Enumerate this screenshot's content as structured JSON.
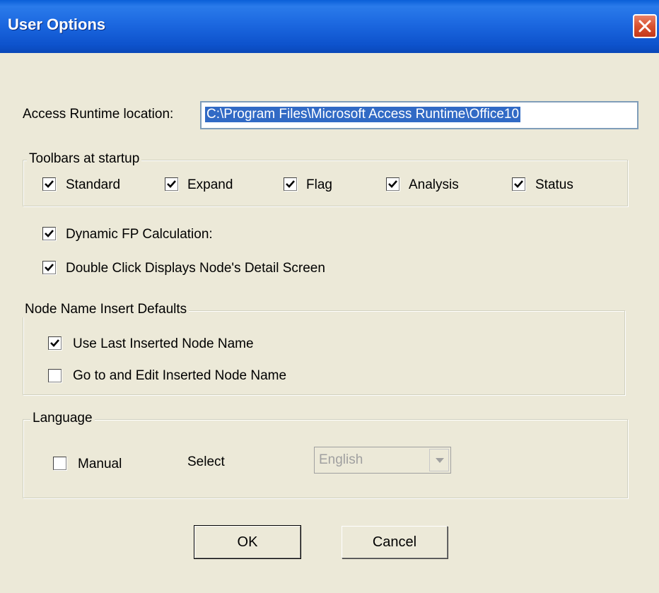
{
  "window": {
    "title": "User Options"
  },
  "runtime": {
    "label": "Access Runtime location:",
    "value": "C:\\Program Files\\Microsoft Access Runtime\\Office10"
  },
  "toolbars": {
    "legend": "Toolbars at startup",
    "items": [
      {
        "label": "Standard",
        "checked": true
      },
      {
        "label": "Expand",
        "checked": true
      },
      {
        "label": "Flag",
        "checked": true
      },
      {
        "label": "Analysis",
        "checked": true
      },
      {
        "label": "Status",
        "checked": true
      }
    ]
  },
  "options": {
    "dynamic_fp": {
      "label": "Dynamic FP Calculation:",
      "checked": true
    },
    "double_click": {
      "label": "Double Click Displays Node's Detail Screen",
      "checked": true
    }
  },
  "node_defaults": {
    "legend": "Node Name Insert Defaults",
    "use_last": {
      "label": "Use Last Inserted Node Name",
      "checked": true
    },
    "go_to_edit": {
      "label": "Go to and Edit Inserted Node Name",
      "checked": false
    }
  },
  "language": {
    "legend": "Language",
    "manual": {
      "label": "Manual",
      "checked": false
    },
    "select_label": "Select",
    "selected_value": "English"
  },
  "buttons": {
    "ok": "OK",
    "cancel": "Cancel"
  },
  "icons": {
    "close": "close-icon",
    "check": "checkmark-icon",
    "dropdown": "chevron-down-icon"
  },
  "colors": {
    "titlebar": "#0a5fd8",
    "dialog_bg": "#ece9d8",
    "close_button": "#d8512f",
    "selection": "#316ac5"
  }
}
